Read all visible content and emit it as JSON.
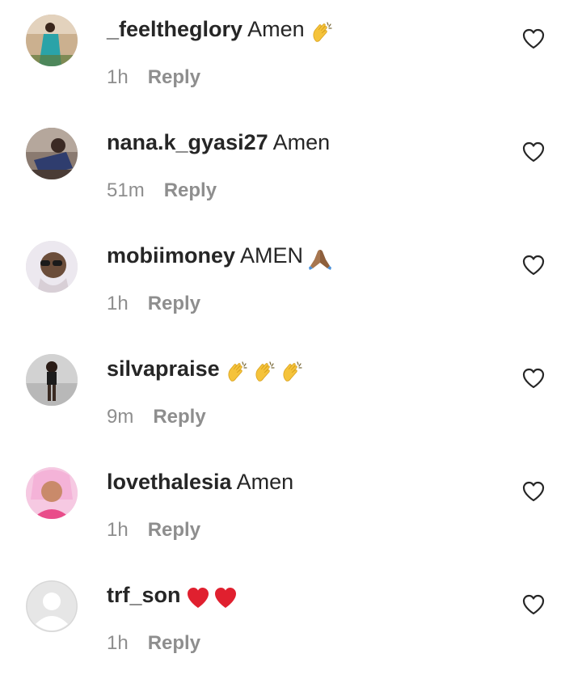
{
  "comments": [
    {
      "username": "_feeltheglory",
      "text": "Amen",
      "emojis": [
        "clapping-hands"
      ],
      "time": "1h",
      "reply_label": "Reply",
      "avatar_colors": [
        "#c9a98a",
        "#2aa3a8"
      ]
    },
    {
      "username": "nana.k_gyasi27",
      "text": "Amen",
      "emojis": [],
      "time": "51m",
      "reply_label": "Reply",
      "avatar_colors": [
        "#6b5a52",
        "#2f3d6e"
      ]
    },
    {
      "username": "mobiimoney",
      "text": "AMEN",
      "emojis": [
        "folded-hands"
      ],
      "time": "1h",
      "reply_label": "Reply",
      "avatar_colors": [
        "#e9e4ec",
        "#6b4d3a"
      ]
    },
    {
      "username": "silvapraise",
      "text": "",
      "emojis": [
        "clapping-hands",
        "clapping-hands",
        "clapping-hands"
      ],
      "time": "9m",
      "reply_label": "Reply",
      "avatar_colors": [
        "#cfcfcf",
        "#3a2a22"
      ]
    },
    {
      "username": "lovethalesia",
      "text": "Amen",
      "emojis": [],
      "time": "1h",
      "reply_label": "Reply",
      "avatar_colors": [
        "#f4b3d8",
        "#e94d8a"
      ]
    },
    {
      "username": "trf_son",
      "text": "",
      "emojis": [
        "red-heart",
        "red-heart"
      ],
      "time": "1h",
      "reply_label": "Reply",
      "avatar_colors": [
        "#e6e6e6",
        "#ffffff"
      ]
    }
  ]
}
